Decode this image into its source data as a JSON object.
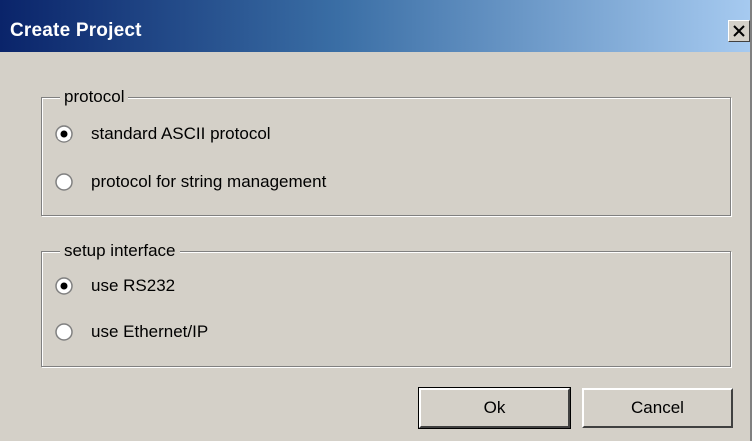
{
  "window": {
    "title": "Create Project",
    "close_label": "X"
  },
  "groups": [
    {
      "legend": "protocol",
      "options": [
        {
          "label": "standard ASCII protocol",
          "checked": true
        },
        {
          "label": "protocol for string management",
          "checked": false
        }
      ]
    },
    {
      "legend": "setup interface",
      "options": [
        {
          "label": "use RS232",
          "checked": true
        },
        {
          "label": "use Ethernet/IP",
          "checked": false
        }
      ]
    }
  ],
  "buttons": {
    "ok": "Ok",
    "cancel": "Cancel"
  }
}
